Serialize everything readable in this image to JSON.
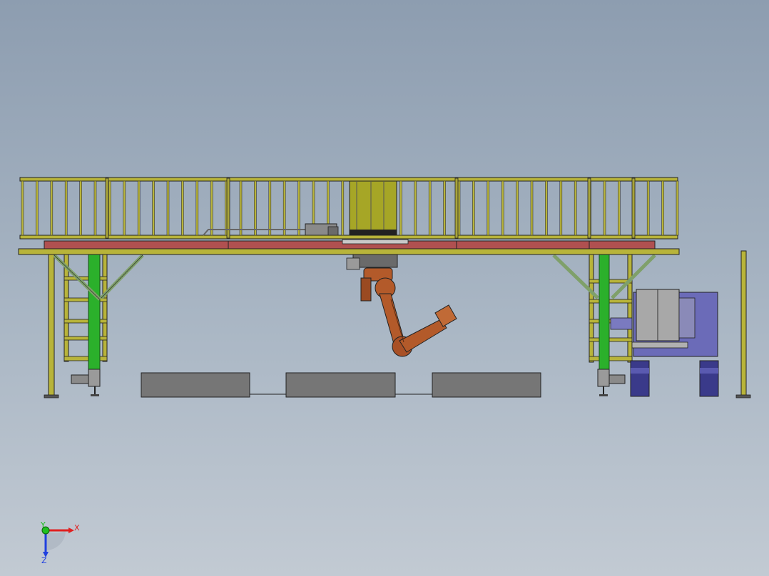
{
  "triad": {
    "x_label": "X",
    "y_label": "Y",
    "z_label": "Z"
  },
  "colors": {
    "background_top": "#8d9db0",
    "background_bottom": "#c2cad3",
    "frame_yellow": "#b8b43a",
    "leg_green": "#2bb02b",
    "rail_red": "#b05050",
    "robot_orange": "#b35a2a",
    "cart_blue": "#6b6bb8",
    "fixture_gray": "#7a7a7a",
    "triad_x": "#e02020",
    "triad_y": "#20c020",
    "triad_z": "#2040e0"
  }
}
